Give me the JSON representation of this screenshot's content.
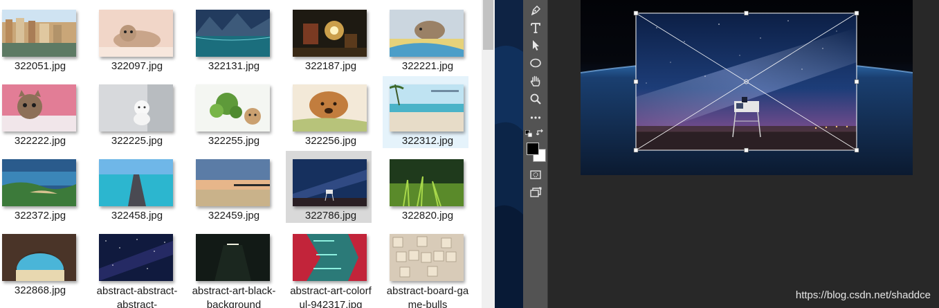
{
  "browser": {
    "top_fragments": [
      "",
      "",
      "",
      "",
      ""
    ],
    "rows": [
      {
        "items": [
          {
            "name": "322051.jpg",
            "art": "canal"
          },
          {
            "name": "322097.jpg",
            "art": "kitten-lying"
          },
          {
            "name": "322131.jpg",
            "art": "lake"
          },
          {
            "name": "322187.jpg",
            "art": "gnome"
          },
          {
            "name": "322221.jpg",
            "art": "kitten-blanket"
          }
        ]
      },
      {
        "items": [
          {
            "name": "322222.jpg",
            "art": "kitten-pink"
          },
          {
            "name": "322225.jpg",
            "art": "white-kitten"
          },
          {
            "name": "322255.jpg",
            "art": "kitten-plant"
          },
          {
            "name": "322256.jpg",
            "art": "puppy"
          },
          {
            "name": "322312.jpg",
            "art": "beach",
            "state": "hover"
          }
        ]
      },
      {
        "items": [
          {
            "name": "322372.jpg",
            "art": "coast"
          },
          {
            "name": "322458.jpg",
            "art": "pier"
          },
          {
            "name": "322459.jpg",
            "art": "jetty"
          },
          {
            "name": "322786.jpg",
            "art": "night-tower",
            "state": "selected"
          },
          {
            "name": "322820.jpg",
            "art": "grass"
          }
        ]
      },
      {
        "items": [
          {
            "name": "322868.jpg",
            "art": "cave"
          },
          {
            "name": "abstract-abstract-abstract-",
            "art": "stars"
          },
          {
            "name": "abstract-art-black-background",
            "art": "dark-room"
          },
          {
            "name": "abstract-art-colorful-942317.jpg",
            "art": "neon"
          },
          {
            "name": "abstract-board-game-bulls",
            "art": "tiles"
          }
        ]
      }
    ]
  },
  "toolbar": {
    "tools": [
      {
        "name": "pen-tool-icon"
      },
      {
        "name": "type-tool-icon"
      },
      {
        "name": "path-selection-tool-icon"
      },
      {
        "name": "ellipse-tool-icon"
      },
      {
        "name": "hand-tool-icon"
      },
      {
        "name": "zoom-tool-icon"
      },
      {
        "name": "more-tools-icon"
      }
    ],
    "foreground_color": "#000000",
    "background_color": "#ffffff"
  },
  "workspace": {
    "watermark": "https://blog.csdn.net/shaddce"
  }
}
